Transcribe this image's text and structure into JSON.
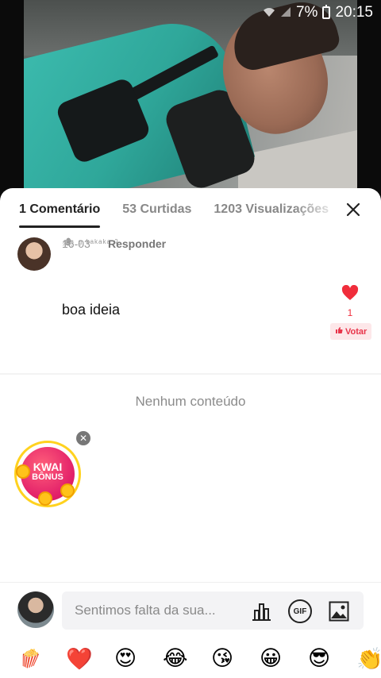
{
  "status_bar": {
    "battery": "7%",
    "time": "20:15"
  },
  "tabs": [
    {
      "label": "1 Comentário",
      "active": true
    },
    {
      "label": "53 Curtidas",
      "active": false
    },
    {
      "label": "1203 Visualizações",
      "active": false
    }
  ],
  "close_icon": "close-icon",
  "comment": {
    "username": "🕷 ᵍ ᵏᵃᵏᵃᵏᵃ ˀ",
    "text": "boa ideia",
    "date": "16-03",
    "reply_label": "Responder",
    "likes": "1",
    "vote_label": "Votar"
  },
  "empty_state": "Nenhum conteúdo",
  "bonus": {
    "line1": "KWAI",
    "line2": "BÔNUS"
  },
  "input": {
    "placeholder": "Sentimos falta da sua...",
    "gif_label": "GIF"
  },
  "emojis": [
    "🍿",
    "❤️",
    "😍",
    "😂",
    "😘",
    "😀",
    "😎",
    "👏"
  ],
  "colors": {
    "accent_red": "#f02d3b",
    "bonus_pink": "#e11d69",
    "bonus_gold": "#ffd21f"
  }
}
